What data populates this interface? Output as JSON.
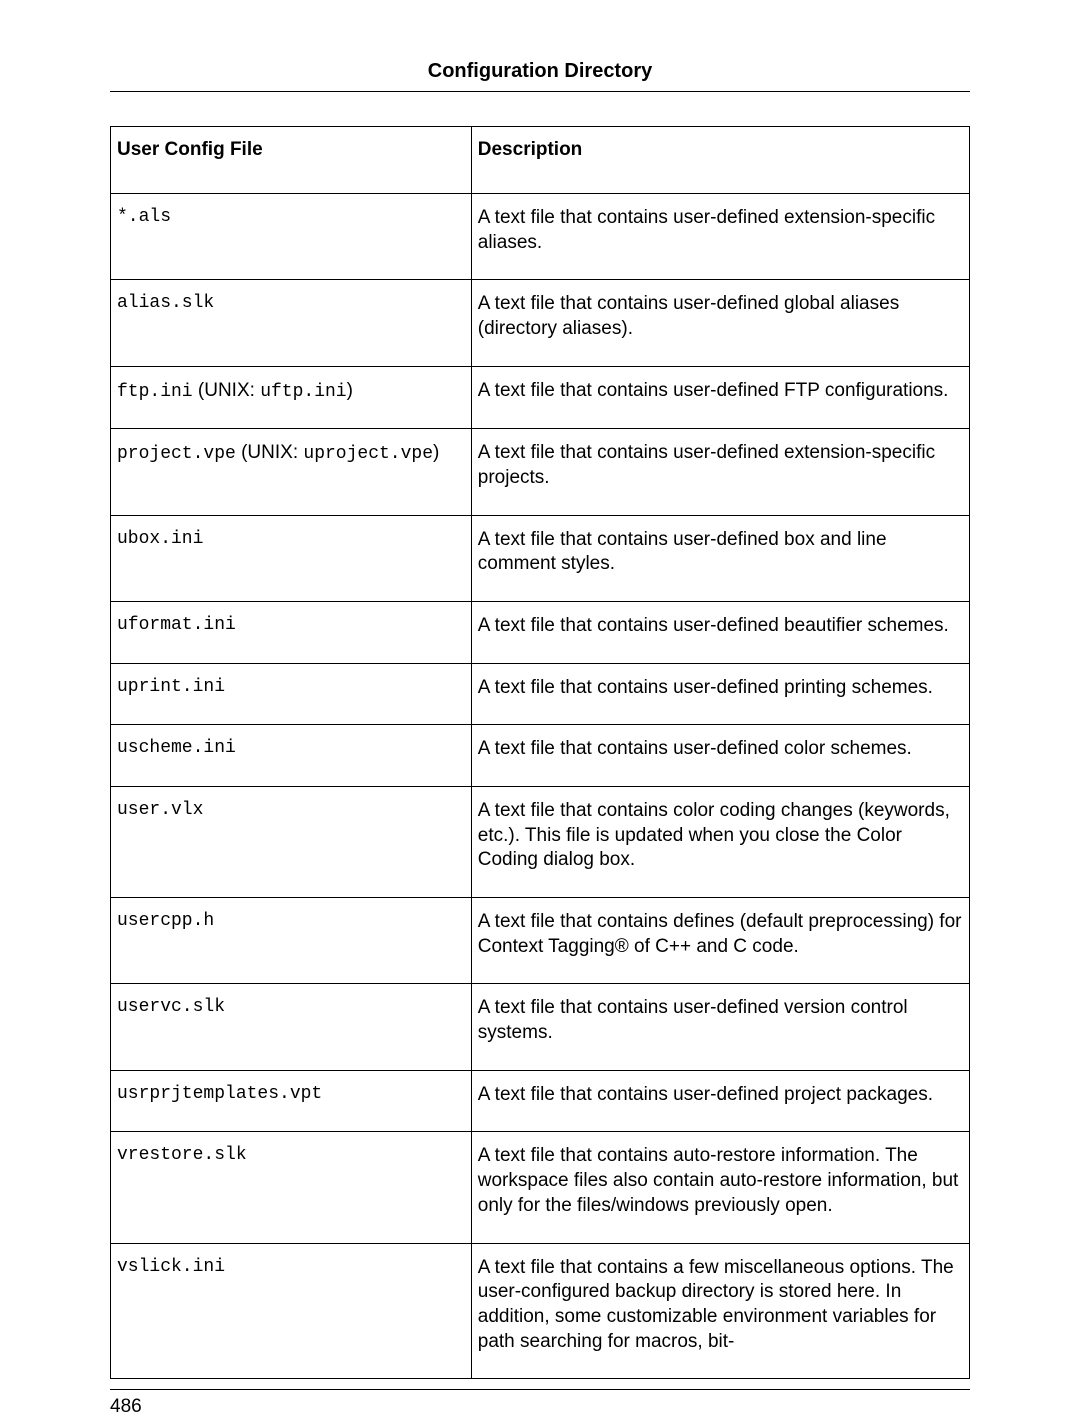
{
  "header": {
    "title": "Configuration Directory"
  },
  "table": {
    "columns": [
      "User Config File",
      "Description"
    ],
    "rows": [
      {
        "file_parts": [
          "*.als"
        ],
        "unix_parts": null,
        "desc": "A text file that contains user-defined extension-specific aliases."
      },
      {
        "file_parts": [
          "alias.slk"
        ],
        "unix_parts": null,
        "desc": "A text file that contains user-defined global aliases (directory aliases)."
      },
      {
        "file_parts": [
          "ftp.ini"
        ],
        "unix_parts": [
          "uftp.ini"
        ],
        "desc": "A text file that contains user-defined FTP configurations."
      },
      {
        "file_parts": [
          "project.vpe"
        ],
        "unix_parts": [
          "uproject.vpe"
        ],
        "desc": "A text file that contains user-defined extension-specific projects."
      },
      {
        "file_parts": [
          "ubox.ini"
        ],
        "unix_parts": null,
        "desc": "A text file that contains user-defined box and line comment styles."
      },
      {
        "file_parts": [
          "uformat.ini"
        ],
        "unix_parts": null,
        "desc": "A text file that contains user-defined beautifier schemes."
      },
      {
        "file_parts": [
          "uprint.ini"
        ],
        "unix_parts": null,
        "desc": "A text file that contains user-defined printing schemes."
      },
      {
        "file_parts": [
          "uscheme.ini"
        ],
        "unix_parts": null,
        "desc": "A text file that contains user-defined color schemes."
      },
      {
        "file_parts": [
          "user.vlx"
        ],
        "unix_parts": null,
        "desc": "A text file that contains color coding changes (keywords, etc.). This file is updated when you close the Color Coding dialog box."
      },
      {
        "file_parts": [
          "usercpp.h"
        ],
        "unix_parts": null,
        "desc": "A text file that contains defines (default preprocessing) for Context Tagging® of C++ and C code."
      },
      {
        "file_parts": [
          "uservc.slk"
        ],
        "unix_parts": null,
        "desc": "A text file that contains user-defined version control systems."
      },
      {
        "file_parts": [
          "usrprjtemplates.vpt"
        ],
        "unix_parts": null,
        "desc": "A text file that contains user-defined project packages."
      },
      {
        "file_parts": [
          "vrestore.slk"
        ],
        "unix_parts": null,
        "desc": "A text file that contains auto-restore information. The workspace files also contain auto-restore information, but only for the files/windows previously open."
      },
      {
        "file_parts": [
          "vslick.ini"
        ],
        "unix_parts": null,
        "desc": "A text file that contains a few miscellaneous options. The user-configured backup directory is stored here. In addition, some customizable environment variables for path searching for macros, bit-"
      }
    ],
    "unix_label": "UNIX:"
  },
  "footer": {
    "page_number": "486"
  }
}
